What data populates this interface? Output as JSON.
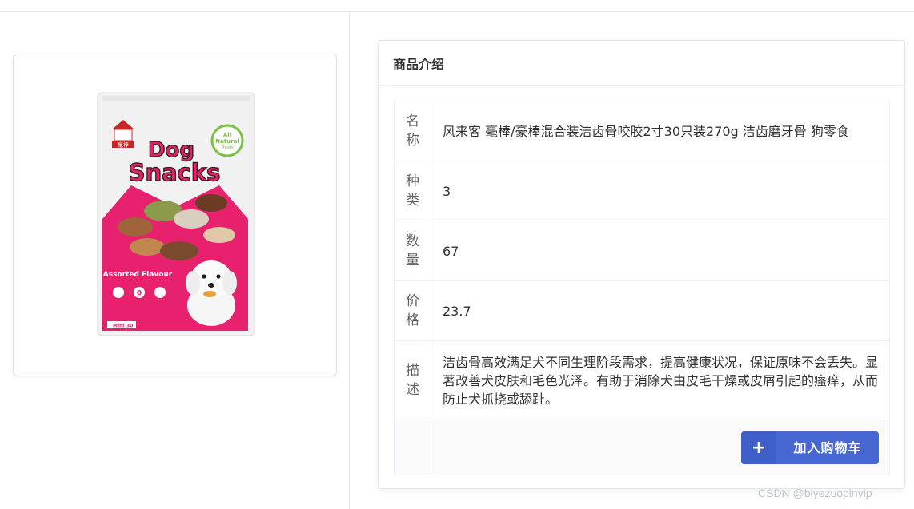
{
  "product_image": {
    "brand_mark": "毫棒",
    "badge_text_1": "All",
    "badge_text_2": "Natural",
    "badge_text_3": "Treats",
    "title_line_1": "Dog",
    "title_line_2": "Snacks",
    "flavour": "Assorted  Flavour",
    "size_label": "Mini",
    "size_value": "30",
    "icon_values": [
      "0"
    ]
  },
  "info_card": {
    "title": "商品介绍",
    "rows": [
      {
        "label": "名称",
        "value": "风来客 毫棒/豪棒混合装洁齿骨咬胶2寸30只装270g 洁齿磨牙骨 狗零食"
      },
      {
        "label": "种类",
        "value": "3"
      },
      {
        "label": "数量",
        "value": "67"
      },
      {
        "label": "价格",
        "value": "23.7"
      },
      {
        "label": "描述",
        "value": "洁齿骨高效满足犬不同生理阶段需求，提高健康状况，保证原味不会丢失。显著改善犬皮肤和毛色光泽。有助于消除犬由皮毛干燥或皮屑引起的瘙痒，从而防止犬抓挠或舔趾。"
      }
    ],
    "add_to_cart": {
      "icon": "plus-icon",
      "label": "加入购物车"
    }
  },
  "watermark": "CSDN @biyezuopinvip",
  "colors": {
    "primary_button": "#4767d3",
    "package_pink": "#e8216f",
    "border": "#ebeef5"
  }
}
